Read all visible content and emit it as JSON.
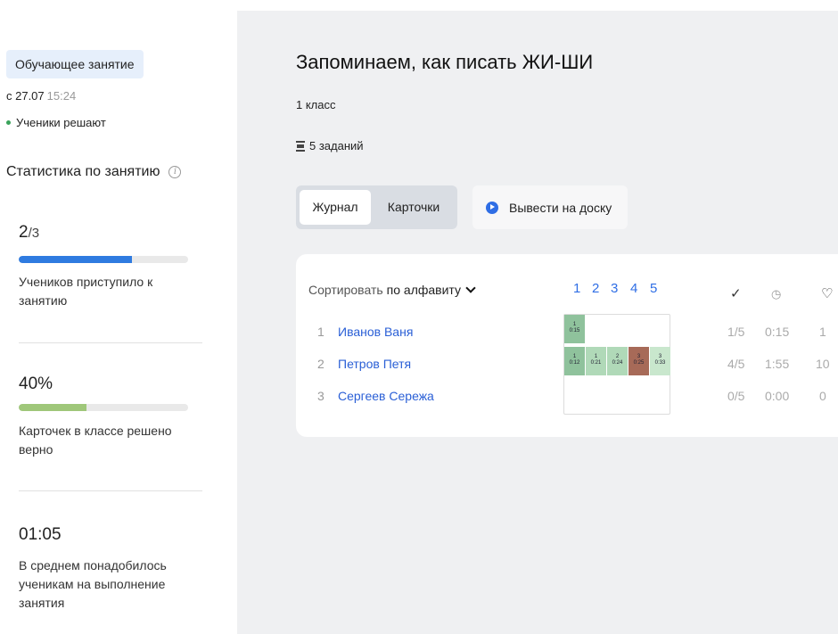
{
  "sidebar": {
    "badge": "Обучающее занятие",
    "date_prefix": "с 27.07",
    "time": "15:24",
    "status": "Ученики решают",
    "stats_title": "Статистика по занятию",
    "stats": [
      {
        "value": "2",
        "total": "/3",
        "progress": 0.67,
        "color": "#2f7be0",
        "desc": "Учеников приступило к занятию"
      },
      {
        "value": "40%",
        "progress": 0.4,
        "color": "#9fc77a",
        "desc": "Карточек в классе решено верно"
      },
      {
        "value": "01:05",
        "desc": "В среднем понадобилось ученикам на выполнение занятия"
      }
    ]
  },
  "main": {
    "title": "Запоминаем, как писать ЖИ-ШИ",
    "grade": "1 класс",
    "tasks": "5 заданий",
    "tabs": [
      {
        "label": "Журнал",
        "active": true
      },
      {
        "label": "Карточки",
        "active": false
      }
    ],
    "board_button": "Вывести на доску",
    "journal": {
      "sort_label": "Сортировать",
      "sort_value": "по алфавиту",
      "task_numbers": [
        "1",
        "2",
        "3",
        "4",
        "5"
      ],
      "column_icons": [
        "checkmark-icon",
        "clock-icon",
        "heart-icon"
      ],
      "column_glyphs": [
        "✓",
        "◷",
        "♡"
      ],
      "students": [
        {
          "index": "1",
          "name": "Иванов Ваня",
          "solved": "1/5",
          "time": "0:15",
          "score": "1"
        },
        {
          "index": "2",
          "name": "Петров Петя",
          "solved": "4/5",
          "time": "1:55",
          "score": "10"
        },
        {
          "index": "3",
          "name": "Сергеев Сережа",
          "solved": "0/5",
          "time": "0:00",
          "score": "0"
        }
      ],
      "attempts": [
        [
          {
            "n": "1",
            "t": "0:15",
            "color": "#8fc29c"
          }
        ],
        [
          {
            "n": "1",
            "t": "0:12",
            "color": "#8fc29c"
          },
          {
            "n": "1",
            "t": "0:21",
            "color": "#b0d9b8"
          },
          {
            "n": "2",
            "t": "0:24",
            "color": "#b0d9b8"
          },
          {
            "n": "3",
            "t": "0:25",
            "color": "#a76a58"
          },
          {
            "n": "3",
            "t": "0:33",
            "color": "#c9e7cd"
          }
        ],
        []
      ]
    }
  }
}
